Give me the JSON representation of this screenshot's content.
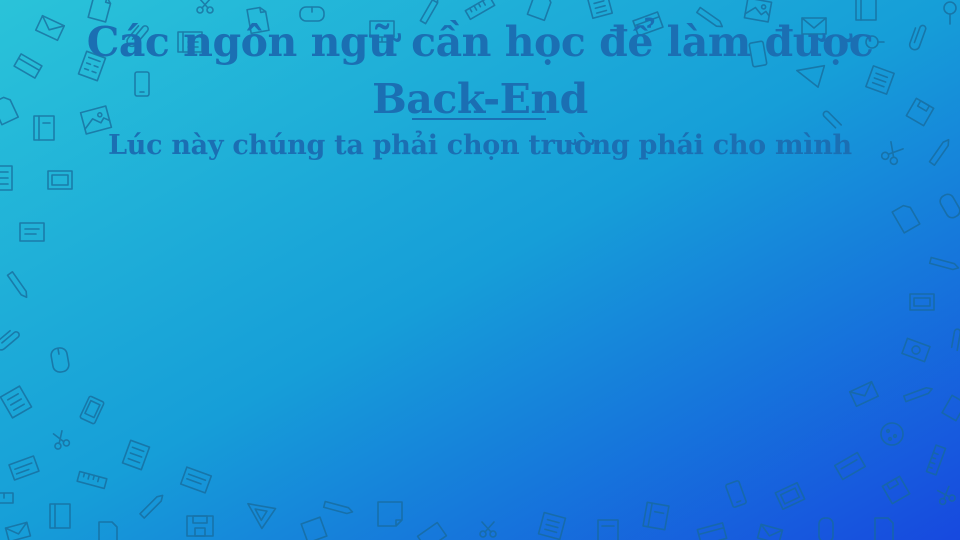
{
  "slide": {
    "title": "Các ngôn ngữ cần học để làm được Back-End",
    "subtitle": "Lúc này chúng ta phải chọn trường phái cho mình"
  },
  "colors": {
    "background_start": "#2ac3d9",
    "background_mid": "#169ed8",
    "background_end": "#1749df",
    "text": "#1b6fb3",
    "icon_stroke": "#186a9a"
  },
  "icons": [
    "envelope-icon",
    "document-icon",
    "pencil-icon",
    "ruler-icon",
    "notebook-icon",
    "calculator-icon",
    "mobile-phone-icon",
    "mouse-icon",
    "scissors-icon",
    "paperclip-icon",
    "image-icon",
    "floppy-disk-icon",
    "triangle-ruler-icon",
    "cookie-icon",
    "notepad-icon",
    "camera-icon",
    "monitor-icon",
    "card-icon",
    "push-pin-icon",
    "sticky-note-icon"
  ]
}
